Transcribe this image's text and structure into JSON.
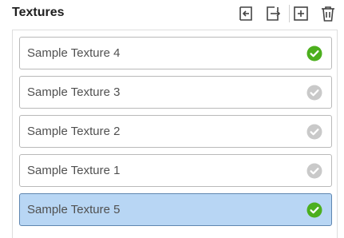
{
  "panel": {
    "title": "Textures"
  },
  "toolbar": {
    "buttons": [
      {
        "icon": "import-icon"
      },
      {
        "icon": "export-icon"
      },
      {
        "icon": "add-icon"
      },
      {
        "icon": "delete-icon"
      }
    ]
  },
  "textures": [
    {
      "name": "Sample Texture 4",
      "checked": true,
      "selected": false
    },
    {
      "name": "Sample Texture 3",
      "checked": false,
      "selected": false
    },
    {
      "name": "Sample Texture 2",
      "checked": false,
      "selected": false
    },
    {
      "name": "Sample Texture 1",
      "checked": false,
      "selected": false
    },
    {
      "name": "Sample Texture 5",
      "checked": true,
      "selected": true
    }
  ],
  "colors": {
    "check_active": "#4caf1e",
    "check_inactive": "#c9c9c9",
    "selected_background": "#b8d6f4",
    "selected_border": "#5f86b0"
  }
}
